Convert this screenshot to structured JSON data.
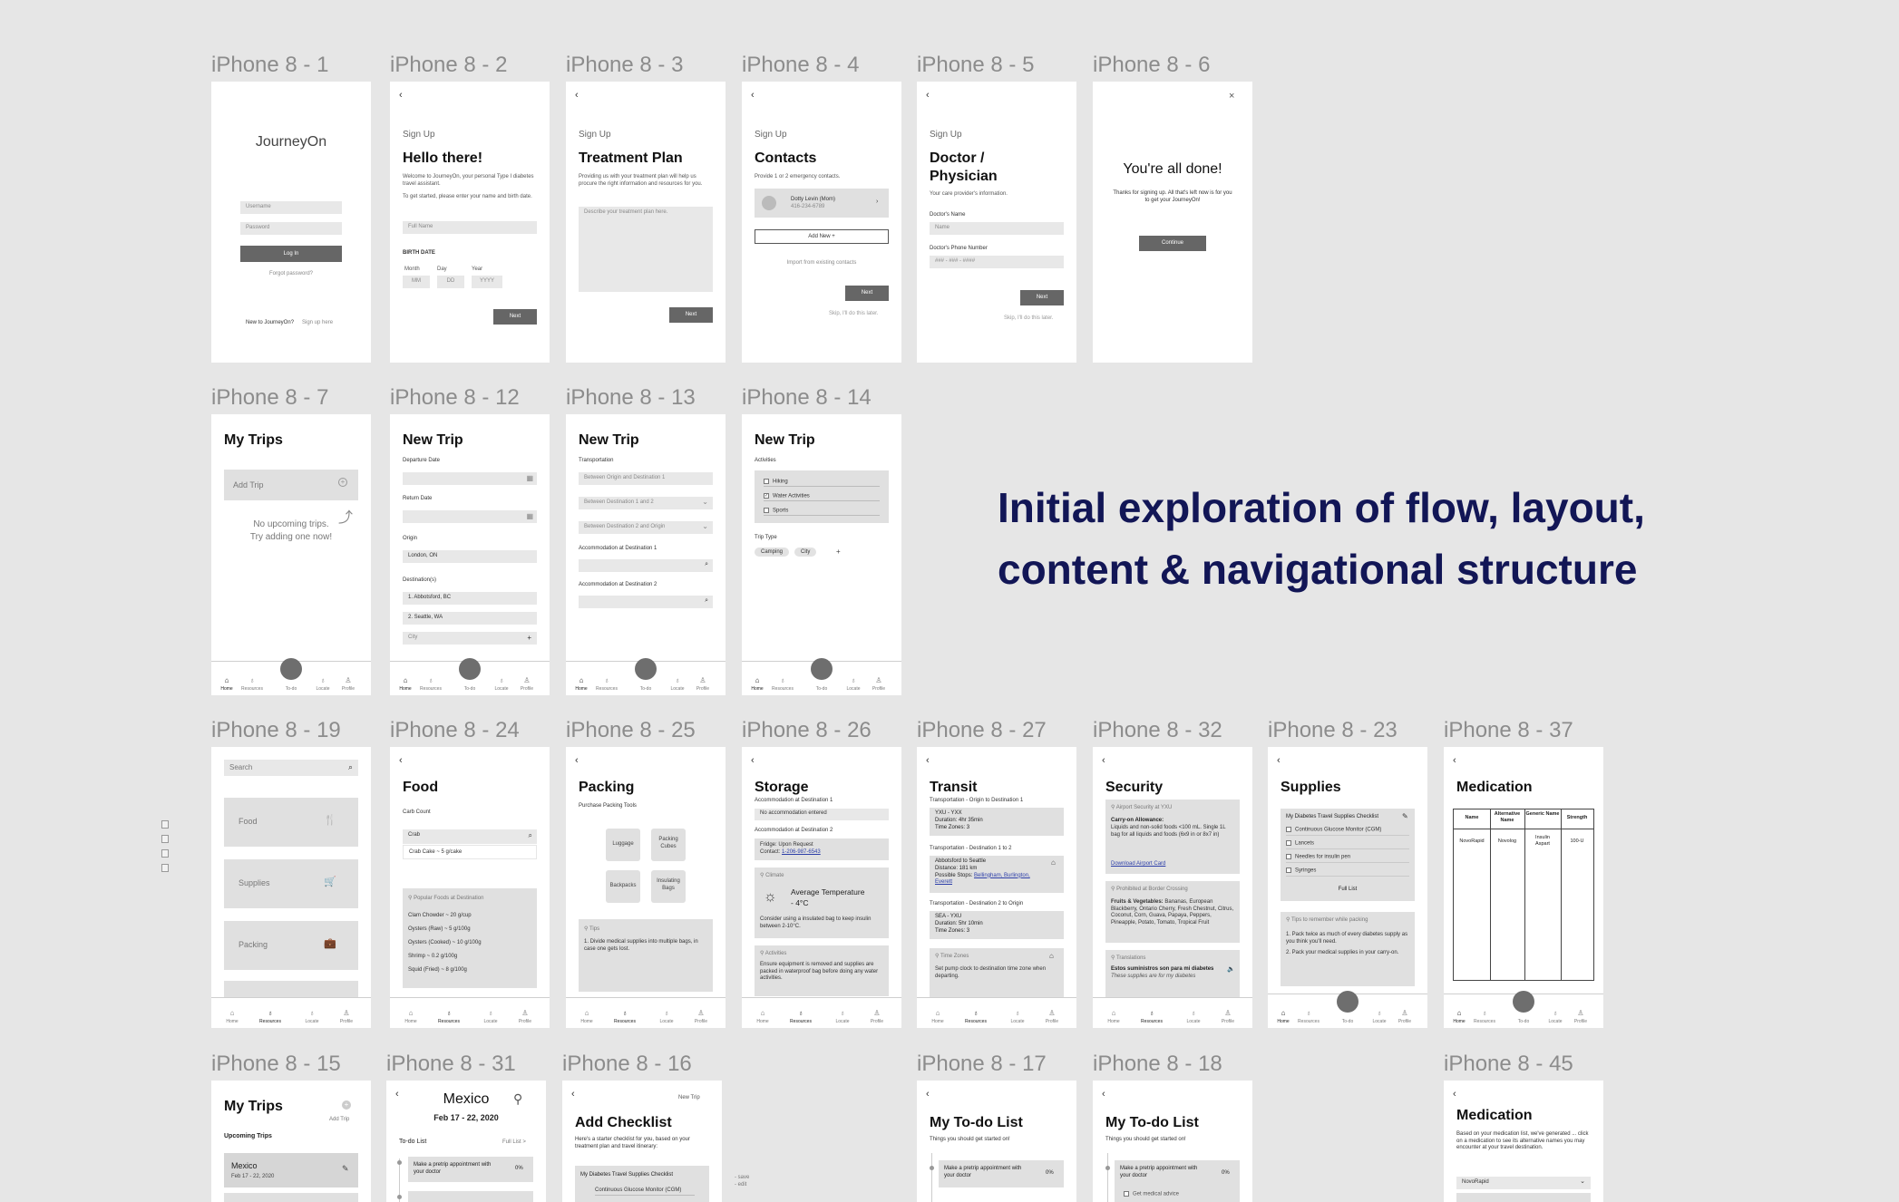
{
  "labels": {
    "s1": "iPhone 8 - 1",
    "s2": "iPhone 8 - 2",
    "s3": "iPhone 8 - 3",
    "s4": "iPhone 8 - 4",
    "s5": "iPhone 8 - 5",
    "s6": "iPhone 8 - 6",
    "s7": "iPhone 8 - 7",
    "s12": "iPhone 8 - 12",
    "s13": "iPhone 8 - 13",
    "s14": "iPhone 8 - 14",
    "s19": "iPhone 8 - 19",
    "s24": "iPhone 8 - 24",
    "s25": "iPhone 8 - 25",
    "s26": "iPhone 8 - 26",
    "s27": "iPhone 8 - 27",
    "s32": "iPhone 8 - 32",
    "s23": "iPhone 8 - 23",
    "s37": "iPhone 8 - 37",
    "s15": "iPhone 8 - 15",
    "s31": "iPhone 8 - 31",
    "s16": "iPhone 8 - 16",
    "s17": "iPhone 8 - 17",
    "s18": "iPhone 8 - 18",
    "s45": "iPhone 8 - 45"
  },
  "headline": {
    "line1": "Initial exploration of flow, layout,",
    "line2": "content & navigational structure"
  },
  "nav": {
    "home": "Home",
    "resources": "Resources",
    "todo": "To-do",
    "locate": "Locate",
    "profile": "Profile"
  },
  "common": {
    "back": "‹",
    "next": "Next",
    "signup": "Sign Up",
    "skip": "Skip, I'll do this later.",
    "new_trip": "New Trip"
  },
  "s1": {
    "logo": "JourneyOn",
    "username": "Username",
    "password": "Password",
    "login": "Log In",
    "forgot": "Forgot password?",
    "new_to": "New to JourneyOn?",
    "signup_here": "Sign up here"
  },
  "s2": {
    "title": "Hello there!",
    "welcome": "Welcome to JourneyOn, your personal Type I diabetes travel assistant.",
    "instr": "To get started, please enter your name and birth date.",
    "full_name": "Full Name",
    "birth_date": "BIRTH DATE",
    "month": "Month",
    "day": "Day",
    "year": "Year",
    "mm": "MM",
    "dd": "DD",
    "yyyy": "YYYY"
  },
  "s3": {
    "title": "Treatment Plan",
    "desc": "Providing us with your treatment plan will help us procure the right information and resources for you.",
    "placeholder": "Describe your treatment plan here."
  },
  "s4": {
    "title": "Contacts",
    "desc": "Provide 1 or 2 emergency contacts.",
    "contact_name": "Dotty Levin (Mom)",
    "contact_phone": "416-234-6789",
    "add_new": "Add New +",
    "import": "Import from existing contacts"
  },
  "s5": {
    "title1": "Doctor /",
    "title2": "Physician",
    "desc": "Your care provider's information.",
    "doc_name_label": "Doctor's Name",
    "doc_name_ph": "Name",
    "doc_phone_label": "Doctor's Phone Number",
    "doc_phone_ph": "### - ### - ####"
  },
  "s6": {
    "close": "×",
    "title": "You're all done!",
    "desc": "Thanks for signing up. All that's left now is for you to get your JourneyOn!",
    "continue": "Continue"
  },
  "s7": {
    "title": "My Trips",
    "add_trip": "Add Trip",
    "empty1": "No upcoming trips.",
    "empty2": "Try adding one now!"
  },
  "s12": {
    "departure": "Departure Date",
    "return": "Return Date",
    "origin": "Origin",
    "origin_val": "London, ON",
    "destinations": "Destination(s)",
    "dest1": "1. Abbotsford, BC",
    "dest2": "2. Seattle, WA",
    "city": "City",
    "plus": "+"
  },
  "s13": {
    "transportation": "Transportation",
    "t1": "Between Origin and Destination 1",
    "t2": "Between Destination 1 and 2",
    "t3": "Between Destination 2 and Origin",
    "acc1": "Accommodation at Destination 1",
    "acc2": "Accommodation at Destination 2"
  },
  "s14": {
    "activities": "Activities",
    "a1": "Hiking",
    "a2": "Water Activities",
    "a3": "Sports",
    "trip_type": "Trip Type",
    "camping": "Camping",
    "city": "City",
    "plus": "+"
  },
  "s19": {
    "search": "Search",
    "food": "Food",
    "supplies": "Supplies",
    "packing": "Packing"
  },
  "s24": {
    "title": "Food",
    "carb": "Carb Count",
    "search_val": "Crab",
    "result": "Crab Cake ~ 5 g/cake",
    "popular": "Popular Foods at Destination",
    "foods": [
      "Clam Chowder ~ 20 g/cup",
      "Oysters (Raw) ~ 5 g/100g",
      "Oysters (Cooked) ~ 10 g/100g",
      "Shrimp ~ 0.2 g/100g",
      "Squid (Fried) ~ 8 g/100g"
    ]
  },
  "s25": {
    "title": "Packing",
    "tools": "Purchase Packing Tools",
    "luggage": "Luggage",
    "cubes": "Packing Cubes",
    "backpacks": "Backpacks",
    "insulating": "Insulating Bags",
    "tips": "Tips",
    "tip1": "1. Divide medical supplies into multiple bags, in case one gets lost."
  },
  "s26": {
    "title": "Storage",
    "acc1": "Accommodation at Destination 1",
    "acc1_val": "No accommodation entered",
    "acc2": "Accommodation at Destination 2",
    "fridge": "Fridge: Upon Request",
    "contact": "Contact:",
    "phone": "1-206-987-6543",
    "climate": "Climate",
    "avg_temp": "Average Temperature",
    "temp": "- 4°C",
    "climate_tip": "Consider using a insulated bag to keep insulin between 2-10°C.",
    "activities": "Activities",
    "act_tip": "Ensure equipment is removed and supplies are packed in waterproof bag before doing any water activities."
  },
  "s27": {
    "title": "Transit",
    "seg1": "Transportation - Origin to Destination 1",
    "seg1_route": "YXU - YXX",
    "seg1_dur": "Duration: 4hr 35min",
    "seg1_tz": "Time Zones: 3",
    "seg2": "Transportation - Destination 1 to 2",
    "seg2_route": "Abbotsford to Seattle",
    "seg2_dist": "Distance: 181 km",
    "seg2_stops": "Possible Stops:",
    "seg2_stop_links": "Bellingham, Burlington, Everett",
    "seg3": "Transportation - Destination 2 to Origin",
    "seg3_route": "SEA - YXU",
    "seg3_dur": "Duration: 5hr 10min",
    "seg3_tz": "Time Zones: 3",
    "tz_title": "Time Zones",
    "tz_tip": "Set pump clock to destination time zone when departing."
  },
  "s32": {
    "title": "Security",
    "airport": "Airport Security at YXU",
    "carry_title": "Carry-on Allowance:",
    "carry": "Liquids and non-solid foods <100 mL. Single 1L bag for all liquids and foods (6x9 in or 8x7 in)",
    "download": "Download Airport Card",
    "prohibited": "Prohibited at Border Crossing",
    "fv_title": "Fruits & Vegetables:",
    "fv": "Bananas, European Blackberry, Ontario Cherry, Fresh Chestnut, Citrus, Coconut, Corn, Guava, Papaya, Peppers, Pineapple, Potato, Tomato, Tropical Fruit",
    "translations": "Translations",
    "es": "Estos suministros son para mi diabetes",
    "en": "These supplies are for my diabetes"
  },
  "s23": {
    "title": "Supplies",
    "checklist": "My Diabetes Travel Supplies Checklist",
    "items": [
      "Continuous Glucose Monitor (CGM)",
      "Lancets",
      "Needles for insulin pen",
      "Syringes"
    ],
    "full_list": "Full List",
    "tips": "Tips to remember while packing",
    "tip1": "1. Pack twice as much of every diabetes supply as you think you'll need.",
    "tip2": "2. Pack your medical supplies in your carry-on."
  },
  "s37": {
    "title": "Medication",
    "cols": [
      "Name",
      "Alternative Name",
      "Generic Name",
      "Strength"
    ],
    "row": [
      "NovoRapid",
      "Novolog",
      "Insulin Aspart",
      "100-U"
    ]
  },
  "s15": {
    "title": "My Trips",
    "add_trip": "Add Trip",
    "upcoming": "Upcoming Trips",
    "trip_name": "Mexico",
    "trip_dates": "Feb 17 - 22, 2020"
  },
  "s31": {
    "title": "Mexico",
    "dates": "Feb 17 - 22, 2020",
    "todo": "To-do List",
    "full_list": "Full List >",
    "item1": "Make a pretrip appointment with your doctor",
    "pct": "0%"
  },
  "s16": {
    "title": "Add Checklist",
    "desc": "Here's a starter checklist for you, based on your treatment plan and travel itinerary:",
    "checklist": "My Diabetes Travel Supplies Checklist",
    "item1": "Continuous Glucose Monitor (CGM)",
    "save": "- save",
    "edit": "- edit"
  },
  "s17": {
    "title": "My To-do List",
    "sub": "Things you should get started on!",
    "item1": "Make a pretrip appointment with your doctor",
    "pct": "0%"
  },
  "s18": {
    "title": "My To-do List",
    "sub": "Things you should get started on!",
    "item1": "Make a pretrip appointment with your doctor",
    "pct": "0%",
    "item2": "Get medical advice"
  },
  "s45": {
    "title": "Medication",
    "desc": "Based on your medication list, we've generated ... click on a medication to see its alternative names you may encounter at your travel destination.",
    "select": "NovoRapid"
  }
}
